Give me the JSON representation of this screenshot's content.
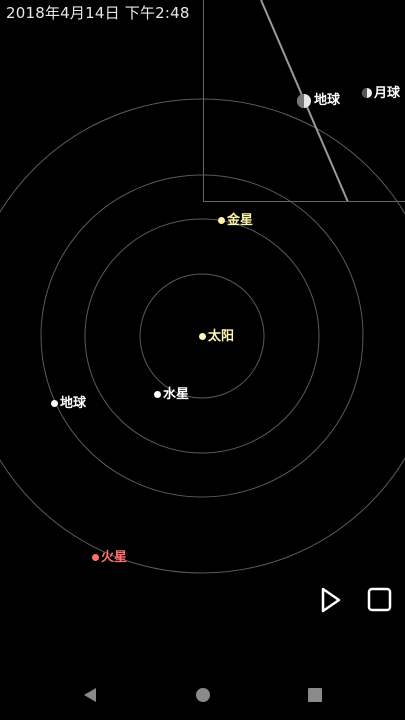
{
  "status": {
    "datetime": "2018年4月14日 下午2:48"
  },
  "bodies": {
    "sun": {
      "label": "太阳",
      "color": "#fdf7b4"
    },
    "mercury": {
      "label": "水星",
      "color": "#ffffff"
    },
    "venus": {
      "label": "金星",
      "color": "#fbf6a8"
    },
    "earth": {
      "label": "地球",
      "color": "#ffffff"
    },
    "mars": {
      "label": "火星",
      "color": "#ff7070"
    }
  },
  "inset": {
    "earth": {
      "label": "地球"
    },
    "moon": {
      "label": "月球"
    }
  },
  "controls": {
    "play_icon": "play-icon",
    "stop_icon": "stop-icon"
  },
  "navbar": {
    "back_icon": "back-triangle-icon",
    "home_icon": "home-circle-icon",
    "recents_icon": "recents-square-icon"
  }
}
